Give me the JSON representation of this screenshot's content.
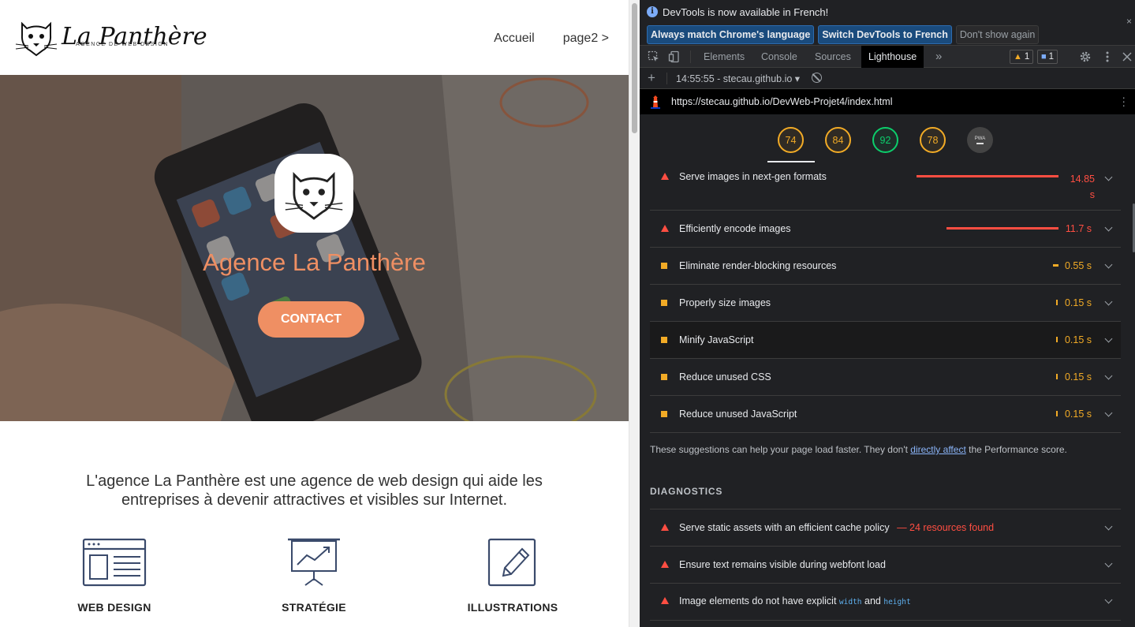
{
  "site": {
    "logo_text": "La Panthère",
    "logo_subtext": "AGENCE DE WEB DESIGN",
    "nav": [
      "Accueil",
      "page2 >"
    ],
    "hero_title": "Agence La Panthère",
    "hero_button": "CONTACT",
    "intro": "L'agence La Panthère est une agence de web design qui aide les entreprises à devenir attractives et visibles sur Internet.",
    "features": [
      {
        "label": "WEB DESIGN",
        "icon": "browser-window-icon"
      },
      {
        "label": "STRATÉGIE",
        "icon": "presentation-chart-icon"
      },
      {
        "label": "ILLUSTRATIONS",
        "icon": "pencil-edit-icon"
      }
    ],
    "accent_color": "#ef8f63"
  },
  "devtools": {
    "infobar": {
      "message": "DevTools is now available in French!",
      "buttons": [
        "Always match Chrome's language",
        "Switch DevTools to French",
        "Don't show again"
      ],
      "close": "×"
    },
    "tabs": [
      "Elements",
      "Console",
      "Sources",
      "Lighthouse"
    ],
    "active_tab": "Lighthouse",
    "more_tabs": "»",
    "warnings_count": "1",
    "messages_count": "1",
    "report_selector": "14:55:55 - stecau.github.io",
    "url": "https://stecau.github.io/DevWeb-Projet4/index.html",
    "scores": [
      {
        "value": "74",
        "status": "average"
      },
      {
        "value": "84",
        "status": "average"
      },
      {
        "value": "92",
        "status": "pass"
      },
      {
        "value": "78",
        "status": "average"
      },
      {
        "value": "PWA",
        "status": "na"
      }
    ],
    "opportunities": [
      {
        "title": "Serve images in next-gen formats",
        "value": "14.85",
        "unit": "s",
        "severity": "fail",
        "bar": 1.0
      },
      {
        "title": "Efficiently encode images",
        "value": "11.7 s",
        "severity": "fail",
        "bar": 0.79
      },
      {
        "title": "Eliminate render-blocking resources",
        "value": "0.55 s",
        "severity": "average",
        "bar": 0.04
      },
      {
        "title": "Properly size images",
        "value": "0.15 s",
        "severity": "average",
        "bar": 0.01
      },
      {
        "title": "Minify JavaScript",
        "value": "0.15 s",
        "severity": "average",
        "bar": 0.01
      },
      {
        "title": "Reduce unused CSS",
        "value": "0.15 s",
        "severity": "average",
        "bar": 0.01
      },
      {
        "title": "Reduce unused JavaScript",
        "value": "0.15 s",
        "severity": "average",
        "bar": 0.01
      }
    ],
    "note_before": "These suggestions can help your page load faster. They don't",
    "note_link": "directly affect",
    "note_after": "the Performance score.",
    "diagnostics_heading": "DIAGNOSTICS",
    "diagnostics": [
      {
        "title": "Serve static assets with an efficient cache policy",
        "extra": "— 24 resources found",
        "severity": "fail"
      },
      {
        "title": "Ensure text remains visible during webfont load",
        "severity": "fail"
      },
      {
        "title": "Image elements do not have explicit",
        "code1": "width",
        "and": "and",
        "code2": "height",
        "severity": "fail"
      }
    ],
    "colors": {
      "fail": "#ff4e42",
      "average": "#f2ab26",
      "pass": "#0cce6b",
      "link": "#8ab4f8"
    }
  }
}
